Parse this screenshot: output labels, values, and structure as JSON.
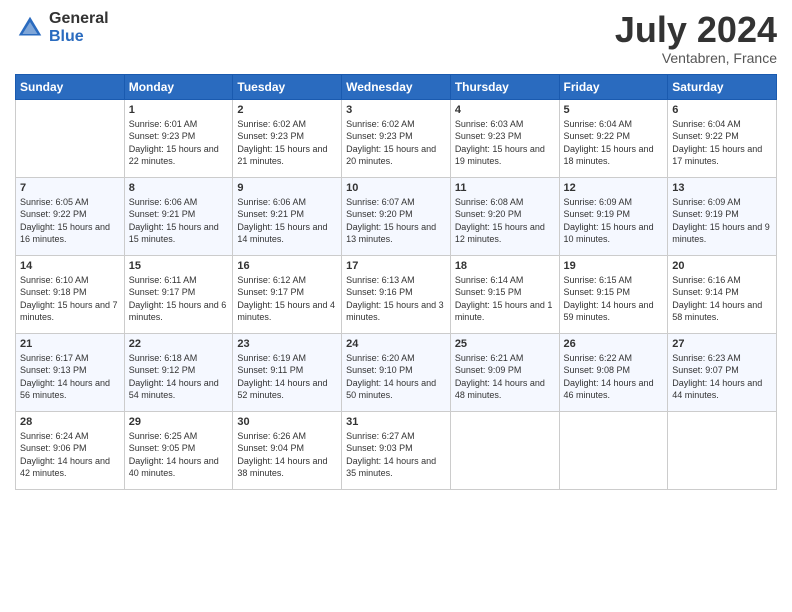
{
  "header": {
    "logo_general": "General",
    "logo_blue": "Blue",
    "month_title": "July 2024",
    "subtitle": "Ventabren, France"
  },
  "days_of_week": [
    "Sunday",
    "Monday",
    "Tuesday",
    "Wednesday",
    "Thursday",
    "Friday",
    "Saturday"
  ],
  "weeks": [
    [
      {
        "day": "",
        "sunrise": "",
        "sunset": "",
        "daylight": ""
      },
      {
        "day": "1",
        "sunrise": "Sunrise: 6:01 AM",
        "sunset": "Sunset: 9:23 PM",
        "daylight": "Daylight: 15 hours and 22 minutes."
      },
      {
        "day": "2",
        "sunrise": "Sunrise: 6:02 AM",
        "sunset": "Sunset: 9:23 PM",
        "daylight": "Daylight: 15 hours and 21 minutes."
      },
      {
        "day": "3",
        "sunrise": "Sunrise: 6:02 AM",
        "sunset": "Sunset: 9:23 PM",
        "daylight": "Daylight: 15 hours and 20 minutes."
      },
      {
        "day": "4",
        "sunrise": "Sunrise: 6:03 AM",
        "sunset": "Sunset: 9:23 PM",
        "daylight": "Daylight: 15 hours and 19 minutes."
      },
      {
        "day": "5",
        "sunrise": "Sunrise: 6:04 AM",
        "sunset": "Sunset: 9:22 PM",
        "daylight": "Daylight: 15 hours and 18 minutes."
      },
      {
        "day": "6",
        "sunrise": "Sunrise: 6:04 AM",
        "sunset": "Sunset: 9:22 PM",
        "daylight": "Daylight: 15 hours and 17 minutes."
      }
    ],
    [
      {
        "day": "7",
        "sunrise": "Sunrise: 6:05 AM",
        "sunset": "Sunset: 9:22 PM",
        "daylight": "Daylight: 15 hours and 16 minutes."
      },
      {
        "day": "8",
        "sunrise": "Sunrise: 6:06 AM",
        "sunset": "Sunset: 9:21 PM",
        "daylight": "Daylight: 15 hours and 15 minutes."
      },
      {
        "day": "9",
        "sunrise": "Sunrise: 6:06 AM",
        "sunset": "Sunset: 9:21 PM",
        "daylight": "Daylight: 15 hours and 14 minutes."
      },
      {
        "day": "10",
        "sunrise": "Sunrise: 6:07 AM",
        "sunset": "Sunset: 9:20 PM",
        "daylight": "Daylight: 15 hours and 13 minutes."
      },
      {
        "day": "11",
        "sunrise": "Sunrise: 6:08 AM",
        "sunset": "Sunset: 9:20 PM",
        "daylight": "Daylight: 15 hours and 12 minutes."
      },
      {
        "day": "12",
        "sunrise": "Sunrise: 6:09 AM",
        "sunset": "Sunset: 9:19 PM",
        "daylight": "Daylight: 15 hours and 10 minutes."
      },
      {
        "day": "13",
        "sunrise": "Sunrise: 6:09 AM",
        "sunset": "Sunset: 9:19 PM",
        "daylight": "Daylight: 15 hours and 9 minutes."
      }
    ],
    [
      {
        "day": "14",
        "sunrise": "Sunrise: 6:10 AM",
        "sunset": "Sunset: 9:18 PM",
        "daylight": "Daylight: 15 hours and 7 minutes."
      },
      {
        "day": "15",
        "sunrise": "Sunrise: 6:11 AM",
        "sunset": "Sunset: 9:17 PM",
        "daylight": "Daylight: 15 hours and 6 minutes."
      },
      {
        "day": "16",
        "sunrise": "Sunrise: 6:12 AM",
        "sunset": "Sunset: 9:17 PM",
        "daylight": "Daylight: 15 hours and 4 minutes."
      },
      {
        "day": "17",
        "sunrise": "Sunrise: 6:13 AM",
        "sunset": "Sunset: 9:16 PM",
        "daylight": "Daylight: 15 hours and 3 minutes."
      },
      {
        "day": "18",
        "sunrise": "Sunrise: 6:14 AM",
        "sunset": "Sunset: 9:15 PM",
        "daylight": "Daylight: 15 hours and 1 minute."
      },
      {
        "day": "19",
        "sunrise": "Sunrise: 6:15 AM",
        "sunset": "Sunset: 9:15 PM",
        "daylight": "Daylight: 14 hours and 59 minutes."
      },
      {
        "day": "20",
        "sunrise": "Sunrise: 6:16 AM",
        "sunset": "Sunset: 9:14 PM",
        "daylight": "Daylight: 14 hours and 58 minutes."
      }
    ],
    [
      {
        "day": "21",
        "sunrise": "Sunrise: 6:17 AM",
        "sunset": "Sunset: 9:13 PM",
        "daylight": "Daylight: 14 hours and 56 minutes."
      },
      {
        "day": "22",
        "sunrise": "Sunrise: 6:18 AM",
        "sunset": "Sunset: 9:12 PM",
        "daylight": "Daylight: 14 hours and 54 minutes."
      },
      {
        "day": "23",
        "sunrise": "Sunrise: 6:19 AM",
        "sunset": "Sunset: 9:11 PM",
        "daylight": "Daylight: 14 hours and 52 minutes."
      },
      {
        "day": "24",
        "sunrise": "Sunrise: 6:20 AM",
        "sunset": "Sunset: 9:10 PM",
        "daylight": "Daylight: 14 hours and 50 minutes."
      },
      {
        "day": "25",
        "sunrise": "Sunrise: 6:21 AM",
        "sunset": "Sunset: 9:09 PM",
        "daylight": "Daylight: 14 hours and 48 minutes."
      },
      {
        "day": "26",
        "sunrise": "Sunrise: 6:22 AM",
        "sunset": "Sunset: 9:08 PM",
        "daylight": "Daylight: 14 hours and 46 minutes."
      },
      {
        "day": "27",
        "sunrise": "Sunrise: 6:23 AM",
        "sunset": "Sunset: 9:07 PM",
        "daylight": "Daylight: 14 hours and 44 minutes."
      }
    ],
    [
      {
        "day": "28",
        "sunrise": "Sunrise: 6:24 AM",
        "sunset": "Sunset: 9:06 PM",
        "daylight": "Daylight: 14 hours and 42 minutes."
      },
      {
        "day": "29",
        "sunrise": "Sunrise: 6:25 AM",
        "sunset": "Sunset: 9:05 PM",
        "daylight": "Daylight: 14 hours and 40 minutes."
      },
      {
        "day": "30",
        "sunrise": "Sunrise: 6:26 AM",
        "sunset": "Sunset: 9:04 PM",
        "daylight": "Daylight: 14 hours and 38 minutes."
      },
      {
        "day": "31",
        "sunrise": "Sunrise: 6:27 AM",
        "sunset": "Sunset: 9:03 PM",
        "daylight": "Daylight: 14 hours and 35 minutes."
      },
      {
        "day": "",
        "sunrise": "",
        "sunset": "",
        "daylight": ""
      },
      {
        "day": "",
        "sunrise": "",
        "sunset": "",
        "daylight": ""
      },
      {
        "day": "",
        "sunrise": "",
        "sunset": "",
        "daylight": ""
      }
    ]
  ]
}
